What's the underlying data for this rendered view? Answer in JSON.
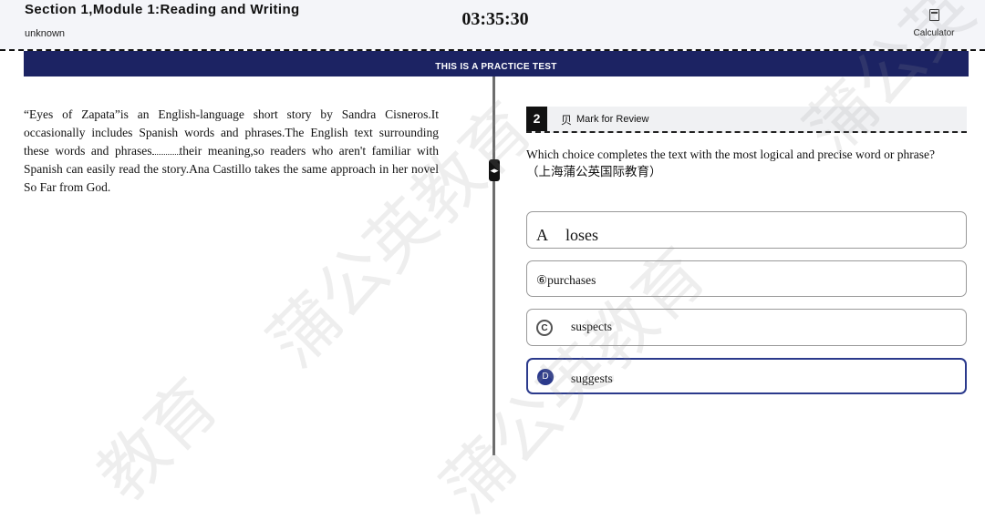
{
  "header": {
    "title": "Section  1,Module  1:Reading  and  Writing",
    "subtitle": "unknown",
    "timer": "03:35:30",
    "calculator_label": "Calculator"
  },
  "banner": {
    "text": "THIS IS A PRACTICE TEST"
  },
  "passage": {
    "line1": "“Eyes of Zapata”is an English-language short story by Sandra Cisneros.It occasionally includes Spanish words and phrases.The English text surrounding these words and phrases",
    "line2": "their meaning,so readers who aren't familiar with Spanish can easily read the story.Ana Castillo takes the same approach in her novel So Far from God."
  },
  "question": {
    "number": "2",
    "mark_icon_glyph": "贝",
    "mark_label": "Mark for Review",
    "text": "Which choice completes the text with the most logical and precise word or phrase?",
    "note": "（上海蒲公英国际教育）"
  },
  "choices": {
    "a": {
      "letter": "A",
      "text": "loses"
    },
    "b": {
      "text": "⑥purchases"
    },
    "c": {
      "letter": "C",
      "text": "suspects"
    },
    "d": {
      "letter": "D",
      "text": "suggests"
    }
  },
  "selected_choice": "D",
  "watermark": {
    "w1": "蒲公英教育",
    "w2": "蒲公英教育",
    "w3": "蒲公英",
    "w4": "教育"
  },
  "colors": {
    "banner": "#1c2363",
    "selected": "#2b3a8c"
  }
}
